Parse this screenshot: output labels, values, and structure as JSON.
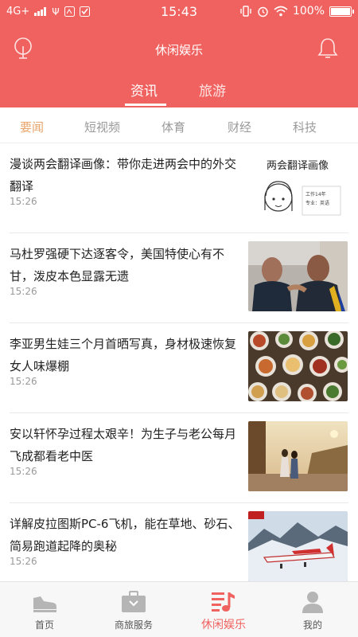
{
  "statusbar": {
    "network": "4G+",
    "time": "15:43",
    "battery": "100%",
    "battery_fraction": 1.0
  },
  "appbar": {
    "title": "休闲娱乐",
    "left_icon": "location-pin-icon",
    "right_icon": "bell-icon"
  },
  "tabs": [
    {
      "label": "资讯",
      "active": true
    },
    {
      "label": "旅游",
      "active": false
    }
  ],
  "categories": [
    {
      "label": "要闻",
      "active": true
    },
    {
      "label": "短视频",
      "active": false
    },
    {
      "label": "体育",
      "active": false
    },
    {
      "label": "财经",
      "active": false
    },
    {
      "label": "科技",
      "active": false
    }
  ],
  "news": [
    {
      "title": "漫谈两会翻译画像：带你走进两会中的外交翻译",
      "time": "15:26",
      "thumb_caption": "两会翻译画像",
      "thumb_lines": [
        "工作14年",
        "专业：英语"
      ]
    },
    {
      "title": "马杜罗强硬下达逐客令，美国特使心有不甘，泼皮本色显露无遗",
      "time": "15:26"
    },
    {
      "title": "李亚男生娃三个月首晒写真，身材极速恢复女人味爆棚",
      "time": "15:26"
    },
    {
      "title": "安以轩怀孕过程太艰辛！为生子与老公每月飞成都看老中医",
      "time": "15:26"
    },
    {
      "title": "详解皮拉图斯PC-6飞机，能在草地、砂石、简易跑道起降的奥秘",
      "time": "15:26"
    }
  ],
  "bottomnav": [
    {
      "label": "首页",
      "icon": "shoe-icon",
      "active": false
    },
    {
      "label": "商旅服务",
      "icon": "suitcase-icon",
      "active": false
    },
    {
      "label": "休闲娱乐",
      "icon": "music-list-icon",
      "active": true
    },
    {
      "label": "我的",
      "icon": "person-icon",
      "active": false
    }
  ],
  "colors": {
    "header_red": "#f0625f",
    "category_active": "#e8a46a",
    "nav_inactive": "#b5b5b5"
  }
}
